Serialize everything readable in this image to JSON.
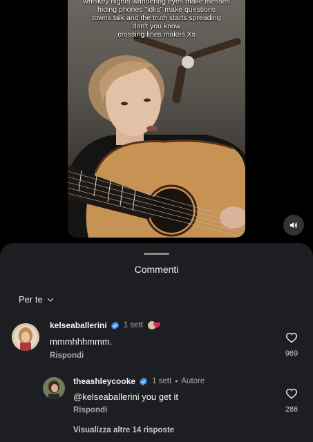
{
  "video": {
    "caption_lines": [
      "whiskey nights wandering eyes make messes",
      "hiding phones \"idks\" make questions",
      "towns talk and the truth starts spreading",
      "don't you know",
      "crossing lines makes Xs"
    ],
    "sound_icon": "speaker-icon"
  },
  "sheet": {
    "title": "Commenti",
    "filter_label": "Per te"
  },
  "comments": [
    {
      "username": "kelseaballerini",
      "time": "1 sett",
      "text": "mmmhhhmmm.",
      "reply_label": "Rispondi",
      "likes": "969"
    },
    {
      "username": "theashleycooke",
      "time": "1 sett",
      "tag": "Autore",
      "text": "@kelseaballerini you get it",
      "reply_label": "Rispondi",
      "likes": "286"
    }
  ],
  "more_replies": "Visualizza altre 14 risposte",
  "colors": {
    "sheet_bg": "#1c1e21",
    "verified_blue": "#3897f0",
    "muted_text": "#a8a8a8"
  }
}
